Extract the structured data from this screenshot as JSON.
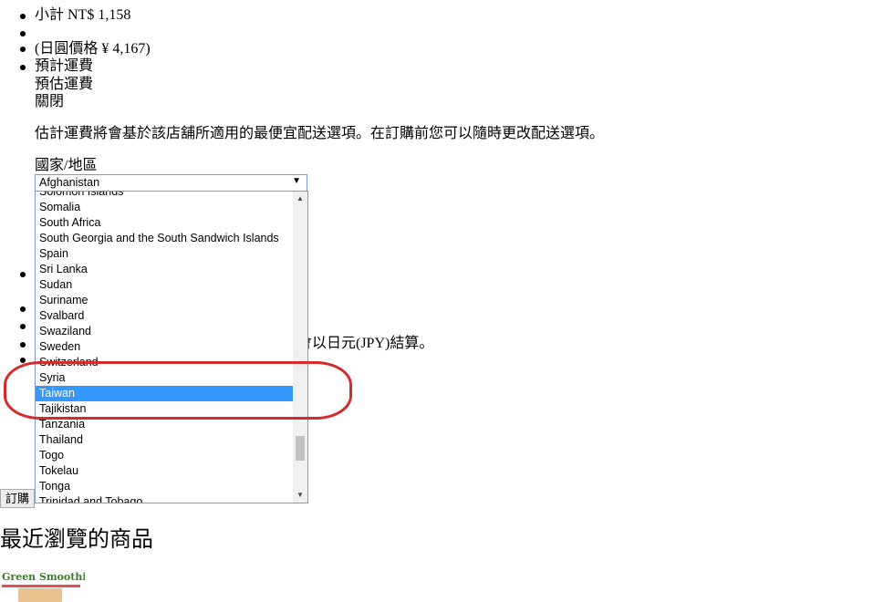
{
  "cart": {
    "subtotal": "小計 NT$ 1,158",
    "jpy_price": "(日圓價格 ¥ 4,167)",
    "shipping_title": "預計運費",
    "shipping_subtitle": "預估運費",
    "close_label": "關閉",
    "shipping_note": "估計運費將會基於該店舖所適用的最便宜配送選項。在訂購前您可以隨時更改配送選項。",
    "country_label": "國家/地區",
    "jpy_note_fragment": "會以日元(JPY)結算。",
    "buy_button": "訂購"
  },
  "country_select": {
    "selected_value": "Afghanistan",
    "arrow_icon": "chevron-down-icon",
    "visible_options": [
      "Solomon Islands",
      "Somalia",
      "South Africa",
      "South Georgia and the South Sandwich Islands",
      "Spain",
      "Sri Lanka",
      "Sudan",
      "Suriname",
      "Svalbard",
      "Swaziland",
      "Sweden",
      "Switzerland",
      "Syria",
      "Taiwan",
      "Tajikistan",
      "Tanzania",
      "Thailand",
      "Togo",
      "Tokelau",
      "Tonga",
      "Trinidad and Tobago"
    ],
    "highlighted_option": "Taiwan"
  },
  "recent": {
    "title": "最近瀏覽的商品",
    "product_brand": "Green Smoothie"
  },
  "colors": {
    "selection": "#3399ff",
    "annotation": "#d62b2b",
    "brand_green": "#3a7a2a"
  }
}
